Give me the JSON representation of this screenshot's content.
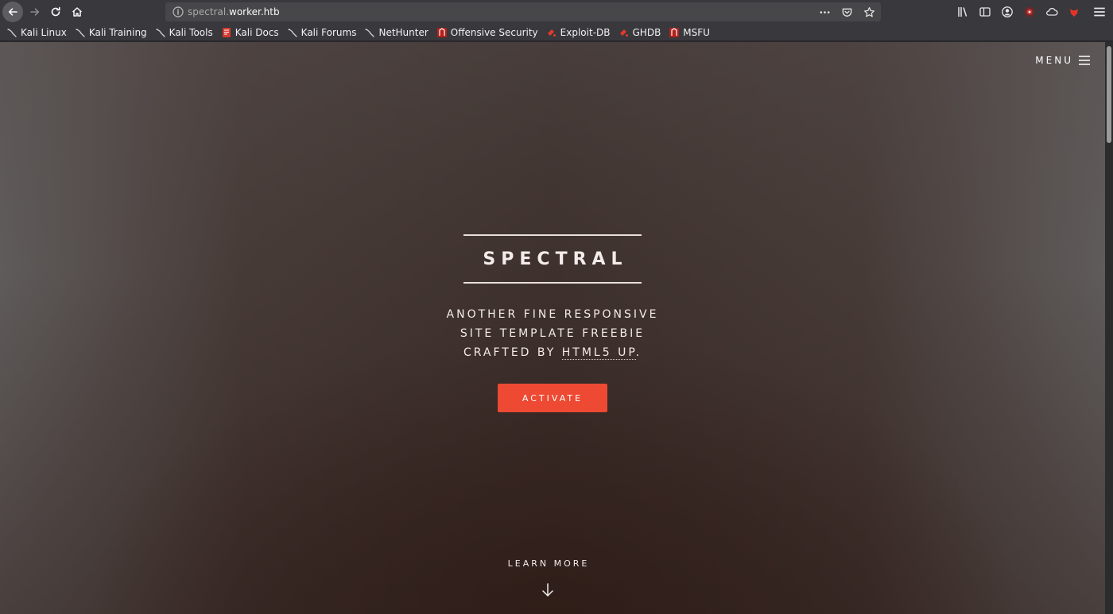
{
  "browser": {
    "url_host_prefix": "spectral.",
    "url_host_main": "worker.htb",
    "bookmarks": [
      {
        "label": "Kali Linux",
        "icon": "kali-dragon-icon"
      },
      {
        "label": "Kali Training",
        "icon": "kali-dragon-icon"
      },
      {
        "label": "Kali Tools",
        "icon": "kali-dragon-icon"
      },
      {
        "label": "Kali Docs",
        "icon": "kali-docs-icon"
      },
      {
        "label": "Kali Forums",
        "icon": "kali-dragon-icon"
      },
      {
        "label": "NetHunter",
        "icon": "kali-dragon-icon"
      },
      {
        "label": "Offensive Security",
        "icon": "offsec-icon"
      },
      {
        "label": "Exploit-DB",
        "icon": "exploit-db-icon"
      },
      {
        "label": "GHDB",
        "icon": "exploit-db-icon"
      },
      {
        "label": "MSFU",
        "icon": "offsec-icon"
      }
    ]
  },
  "page": {
    "menu_label": "MENU",
    "title": "SPECTRAL",
    "tagline_line1": "ANOTHER FINE RESPONSIVE",
    "tagline_line2": "SITE TEMPLATE FREEBIE",
    "tagline_line3_prefix": "CRAFTED BY ",
    "tagline_link": "HTML5 UP",
    "tagline_line3_suffix": ".",
    "activate_label": "ACTIVATE",
    "learn_more_label": "LEARN MORE"
  },
  "colors": {
    "accent": "#ed4933",
    "toolbar": "#38383d"
  }
}
